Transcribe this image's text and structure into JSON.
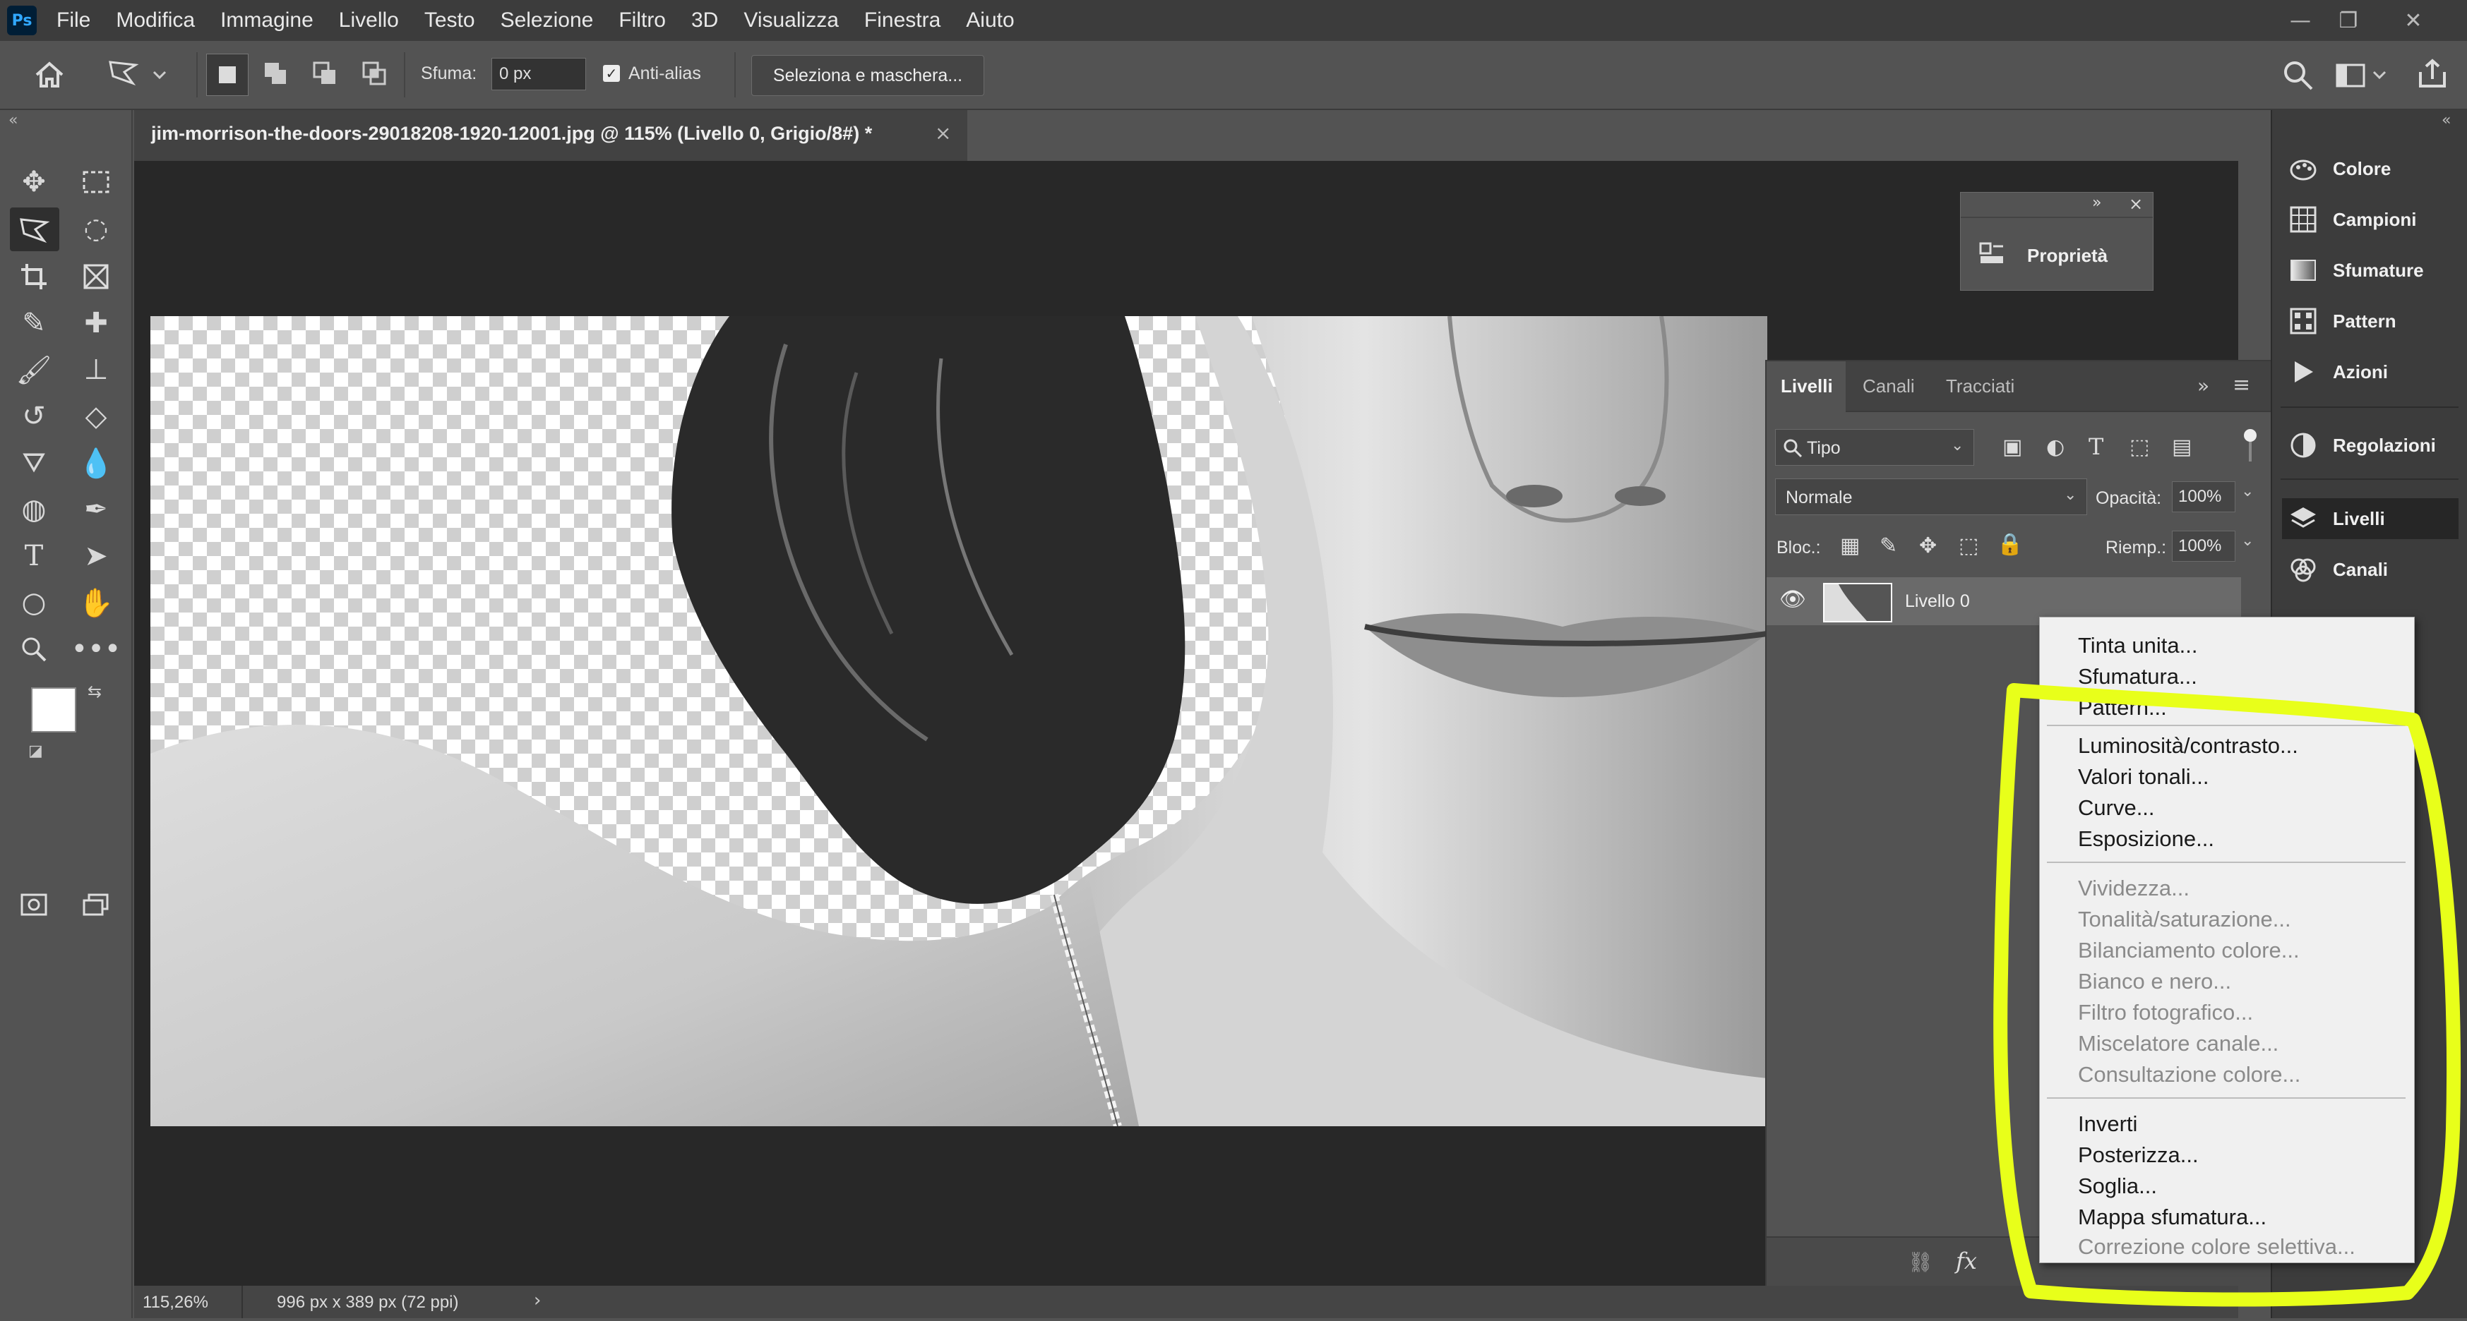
{
  "app": {
    "logo": "Ps",
    "menu": [
      "File",
      "Modifica",
      "Immagine",
      "Livello",
      "Testo",
      "Selezione",
      "Filtro",
      "3D",
      "Visualizza",
      "Finestra",
      "Aiuto"
    ]
  },
  "options": {
    "feather_label": "Sfuma:",
    "feather_value": "0 px",
    "antialias_label": "Anti-alias",
    "mask_button": "Seleziona e maschera..."
  },
  "document": {
    "tab_title": "jim-morrison-the-doors-29018208-1920-12001.jpg @ 115% (Livello 0, Grigio/8#) *",
    "zoom": "115,26%",
    "doc_info": "996 px x 389 px (72 ppi)"
  },
  "properties_panel": {
    "label": "Proprietà"
  },
  "right_dock": {
    "items": [
      {
        "label": "Colore",
        "icon": "palette-icon"
      },
      {
        "label": "Campioni",
        "icon": "swatches-grid-icon"
      },
      {
        "label": "Sfumature",
        "icon": "gradient-icon"
      },
      {
        "label": "Pattern",
        "icon": "pattern-icon"
      },
      {
        "label": "Azioni",
        "icon": "play-icon"
      },
      {
        "label": "Regolazioni",
        "icon": "adjustments-icon"
      },
      {
        "label": "Livelli",
        "icon": "layers-icon"
      },
      {
        "label": "Canali",
        "icon": "channels-icon"
      }
    ]
  },
  "layers_panel": {
    "tabs": [
      "Livelli",
      "Canali",
      "Tracciati"
    ],
    "filter_kind": "Tipo",
    "blend_mode": "Normale",
    "opacity_label": "Opacità:",
    "opacity_value": "100%",
    "lock_label": "Bloc.:",
    "fill_label": "Riemp.:",
    "fill_value": "100%",
    "layer_name": "Livello 0"
  },
  "adjustment_menu": {
    "group1": [
      "Tinta unita...",
      "Sfumatura...",
      "Pattern..."
    ],
    "group2": [
      "Luminosità/contrasto...",
      "Valori tonali...",
      "Curve...",
      "Esposizione..."
    ],
    "group3": [
      "Vividezza...",
      "Tonalità/saturazione...",
      "Bilanciamento colore...",
      "Bianco e nero...",
      "Filtro fotografico...",
      "Miscelatore canale...",
      "Consultazione colore..."
    ],
    "group4": [
      "Inverti",
      "Posterizza...",
      "Soglia...",
      "Mappa sfumatura..."
    ],
    "group4_disabled": [
      "Correzione colore selettiva..."
    ]
  },
  "colors": {
    "highlight": "#e8ff1a",
    "panel_bg": "#535353",
    "menu_bg": "#f0f0f0"
  }
}
